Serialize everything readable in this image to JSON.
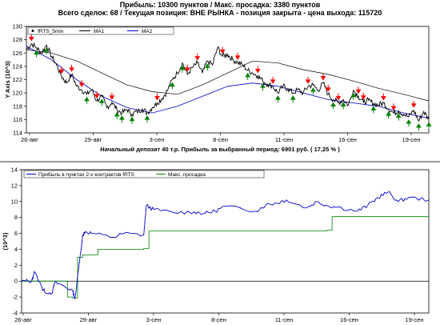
{
  "header": {
    "line1": "Прибыль: 10300 пунктов / Макс. просадка: 3380 пунктов",
    "line2": "Всего сделок: 68 /  Текущая позиция: ВНЕ РЫНКА  - позиция закрыта  - цена выхода: 115720"
  },
  "chart_data": [
    {
      "type": "line",
      "ylabel": "Y Axis (10^3)",
      "xlabel": "Начальный депозит 40 т.р. Прибыль за выбранный период: 6901 руб. ( 17,25 % )",
      "ylim": [
        114,
        130
      ],
      "yticks": [
        "114",
        "116",
        "118",
        "120",
        "122",
        "124",
        "126",
        "128",
        "130"
      ],
      "xticks": [
        "26-авг",
        "29-авг",
        "3-сен",
        "8-сен",
        "11-сен",
        "16-сен",
        "19-сен"
      ],
      "legend": {
        "placement": "top-left",
        "entries": [
          "fRTS_5min",
          "MA1",
          "MA2"
        ]
      },
      "colors": {
        "price": "#000000",
        "ma1": "#000000",
        "ma2": "#0000cc",
        "buy": "#008000",
        "sell": "#ff0000"
      },
      "grid": false,
      "series": [
        {
          "name": "fRTS_5min",
          "x": [
            0,
            1,
            2,
            3,
            4,
            5,
            6,
            7,
            8,
            9,
            10,
            11,
            12,
            13,
            14,
            15,
            16,
            17,
            18,
            19,
            20,
            21,
            22,
            23,
            24,
            25,
            26,
            27,
            28,
            29,
            30,
            31,
            32,
            33,
            34,
            35,
            36,
            37,
            38,
            39,
            40,
            41,
            42,
            43,
            44,
            45,
            46,
            47,
            48,
            49,
            50,
            51,
            52,
            53,
            54,
            55,
            56,
            57,
            58,
            59,
            60,
            61,
            62,
            63,
            64,
            65,
            66,
            67,
            68,
            69,
            70,
            71,
            72,
            73,
            74,
            75,
            76,
            77,
            78,
            79,
            80
          ],
          "values": [
            126.5,
            127.4,
            126.8,
            126.0,
            127.2,
            125.5,
            124.2,
            122.5,
            121.5,
            122.8,
            121.0,
            120.5,
            119.8,
            120.5,
            118.8,
            119.5,
            117.8,
            118.6,
            117.5,
            117.0,
            117.5,
            116.8,
            117.2,
            117.6,
            117.0,
            117.8,
            118.5,
            119.2,
            120.3,
            122.0,
            123.0,
            124.5,
            122.8,
            123.8,
            124.5,
            123.0,
            124.8,
            124.2,
            126.8,
            125.5,
            125.8,
            125.0,
            124.6,
            124.2,
            123.4,
            123.0,
            122.6,
            121.8,
            121.3,
            121.0,
            120.0,
            121.0,
            120.6,
            120.0,
            120.5,
            120.0,
            121.0,
            121.2,
            120.4,
            121.5,
            119.8,
            119.0,
            118.5,
            119.0,
            118.2,
            120.4,
            119.5,
            118.6,
            118.9,
            118.4,
            118.2,
            118.5,
            117.6,
            117.0,
            117.3,
            116.8,
            116.4,
            117.4,
            115.8,
            117.2,
            116.0
          ]
        },
        {
          "name": "MA1",
          "x": [
            0,
            5,
            10,
            15,
            20,
            25,
            30,
            35,
            40,
            45,
            50,
            55,
            60,
            65,
            70,
            75,
            80
          ],
          "values": [
            126.5,
            126.0,
            124.8,
            123.0,
            121.2,
            120.2,
            119.8,
            121.2,
            123.0,
            124.8,
            124.5,
            123.5,
            122.8,
            121.8,
            120.7,
            119.8,
            118.8
          ]
        },
        {
          "name": "MA2",
          "x": [
            0,
            5,
            10,
            15,
            20,
            25,
            30,
            35,
            40,
            45,
            50,
            55,
            60,
            65,
            70,
            75,
            80
          ],
          "values": [
            127.0,
            125.0,
            122.0,
            119.5,
            117.8,
            117.0,
            118.0,
            119.5,
            121.0,
            121.5,
            121.0,
            120.0,
            119.0,
            118.5,
            118.0,
            117.0,
            116.2
          ]
        }
      ],
      "buy_x": [
        2,
        4,
        12,
        15,
        18,
        19,
        21,
        24,
        29,
        31,
        36,
        44,
        47,
        50,
        53,
        57,
        61,
        63,
        65,
        69,
        72,
        74,
        76,
        78,
        80
      ],
      "sell_x": [
        1,
        7,
        9,
        11,
        14,
        17,
        26,
        32,
        34,
        39,
        42,
        46,
        49,
        56,
        59,
        60,
        62,
        66,
        67,
        71,
        73,
        77
      ]
    },
    {
      "type": "line",
      "ylabel": "(10^3)",
      "ylim": [
        -4,
        14
      ],
      "yticks": [
        "-4",
        "-2",
        "0",
        "2",
        "4",
        "6",
        "8",
        "10",
        "12",
        "14"
      ],
      "xticks": [
        "26-авг",
        "29-авг",
        "3-сен",
        "8-сен",
        "11-сен",
        "16-сен",
        "19-сен"
      ],
      "legend": {
        "placement": "top-left",
        "entries": [
          "Прибыль в пунктах 2-х контрактов fRTS",
          "Макс. просадка"
        ]
      },
      "colors": {
        "profit": "#0000cc",
        "drawdown": "#008000",
        "zero": "#000000"
      },
      "series": [
        {
          "name": "Прибыль в пунктах 2-х контрактов fRTS",
          "x": [
            0,
            2,
            2.5,
            4,
            4.5,
            6,
            6.5,
            8,
            10,
            10.5,
            12,
            12.5,
            14,
            18,
            20,
            24,
            24.5,
            26,
            30,
            34,
            36,
            38,
            40,
            46,
            48,
            50,
            52,
            56,
            58,
            60,
            62,
            66,
            68,
            70,
            72,
            74,
            76,
            80
          ],
          "values": [
            0,
            0,
            1.2,
            -0.8,
            -1.3,
            -1.5,
            -0.2,
            -0.5,
            -1.2,
            -2.2,
            5.8,
            6.2,
            6.0,
            5.5,
            6.0,
            5.8,
            9.5,
            9.0,
            8.6,
            8.7,
            8.5,
            8.8,
            9.4,
            8.8,
            9.6,
            9.8,
            10.2,
            9.2,
            10.0,
            9.5,
            9.3,
            8.8,
            9.5,
            10.5,
            11.2,
            10.0,
            10.5,
            10.2
          ]
        },
        {
          "name": "Макс. просадка",
          "x": [
            0,
            9,
            10,
            11,
            12,
            14,
            15,
            24,
            25,
            60,
            61,
            80
          ],
          "values": [
            0,
            -2.0,
            -2.1,
            3.0,
            3.3,
            3.3,
            4.0,
            4.1,
            6.3,
            6.4,
            8.1,
            8.2
          ]
        }
      ]
    }
  ]
}
